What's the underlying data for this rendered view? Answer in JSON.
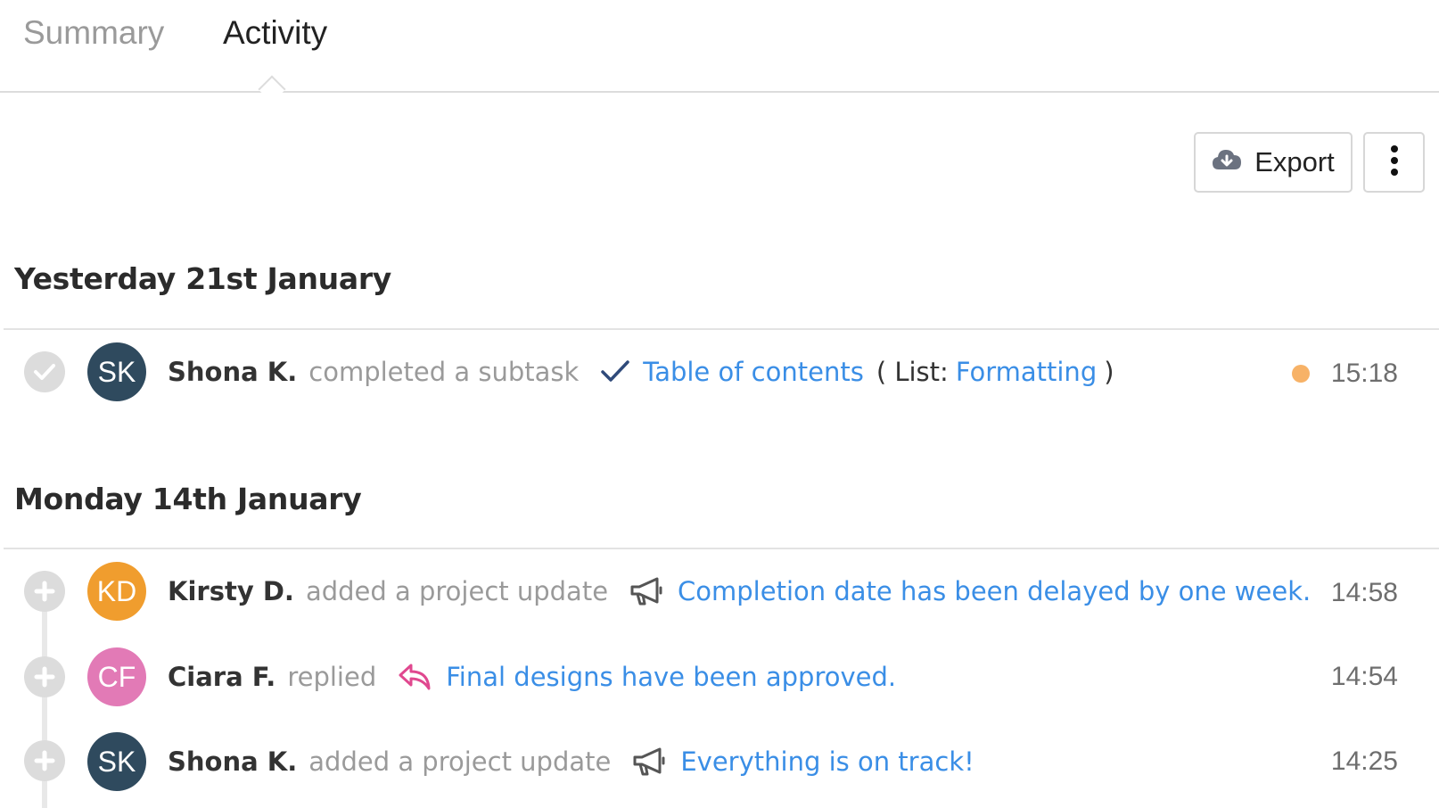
{
  "tabs": [
    {
      "label": "Summary"
    },
    {
      "label": "Activity"
    }
  ],
  "toolbar": {
    "export_label": "Export",
    "export_icon": "cloud-download-icon",
    "more_icon": "vertical-ellipsis-icon"
  },
  "colors": {
    "link": "#3a8ee6",
    "unread_dot": "#f7b267",
    "avatar_sk": "#2f4a5e",
    "avatar_kd": "#f09d2e",
    "avatar_cf": "#e27ab6",
    "reply_icon": "#e0488f"
  },
  "days": [
    {
      "heading": "Yesterday 21st January",
      "items": [
        {
          "initials": "SK",
          "user": "Shona K.",
          "action": "completed a subtask",
          "icon": "checkmark-icon",
          "link": "Table of contents",
          "context_open": "( List:",
          "context_link": "Formatting",
          "context_close": ")",
          "time": "15:18",
          "unread": true
        }
      ]
    },
    {
      "heading": "Monday 14th January",
      "items": [
        {
          "initials": "KD",
          "user": "Kirsty D.",
          "action": "added a project update",
          "icon": "megaphone-icon",
          "link": "Completion date has been delayed by one week.",
          "time": "14:58"
        },
        {
          "initials": "CF",
          "user": "Ciara F.",
          "action": "replied",
          "icon": "reply-icon",
          "link": "Final designs have been approved.",
          "time": "14:54"
        },
        {
          "initials": "SK",
          "user": "Shona K.",
          "action": "added a project update",
          "icon": "megaphone-icon",
          "link": "Everything is on track!",
          "time": "14:25"
        }
      ]
    }
  ]
}
